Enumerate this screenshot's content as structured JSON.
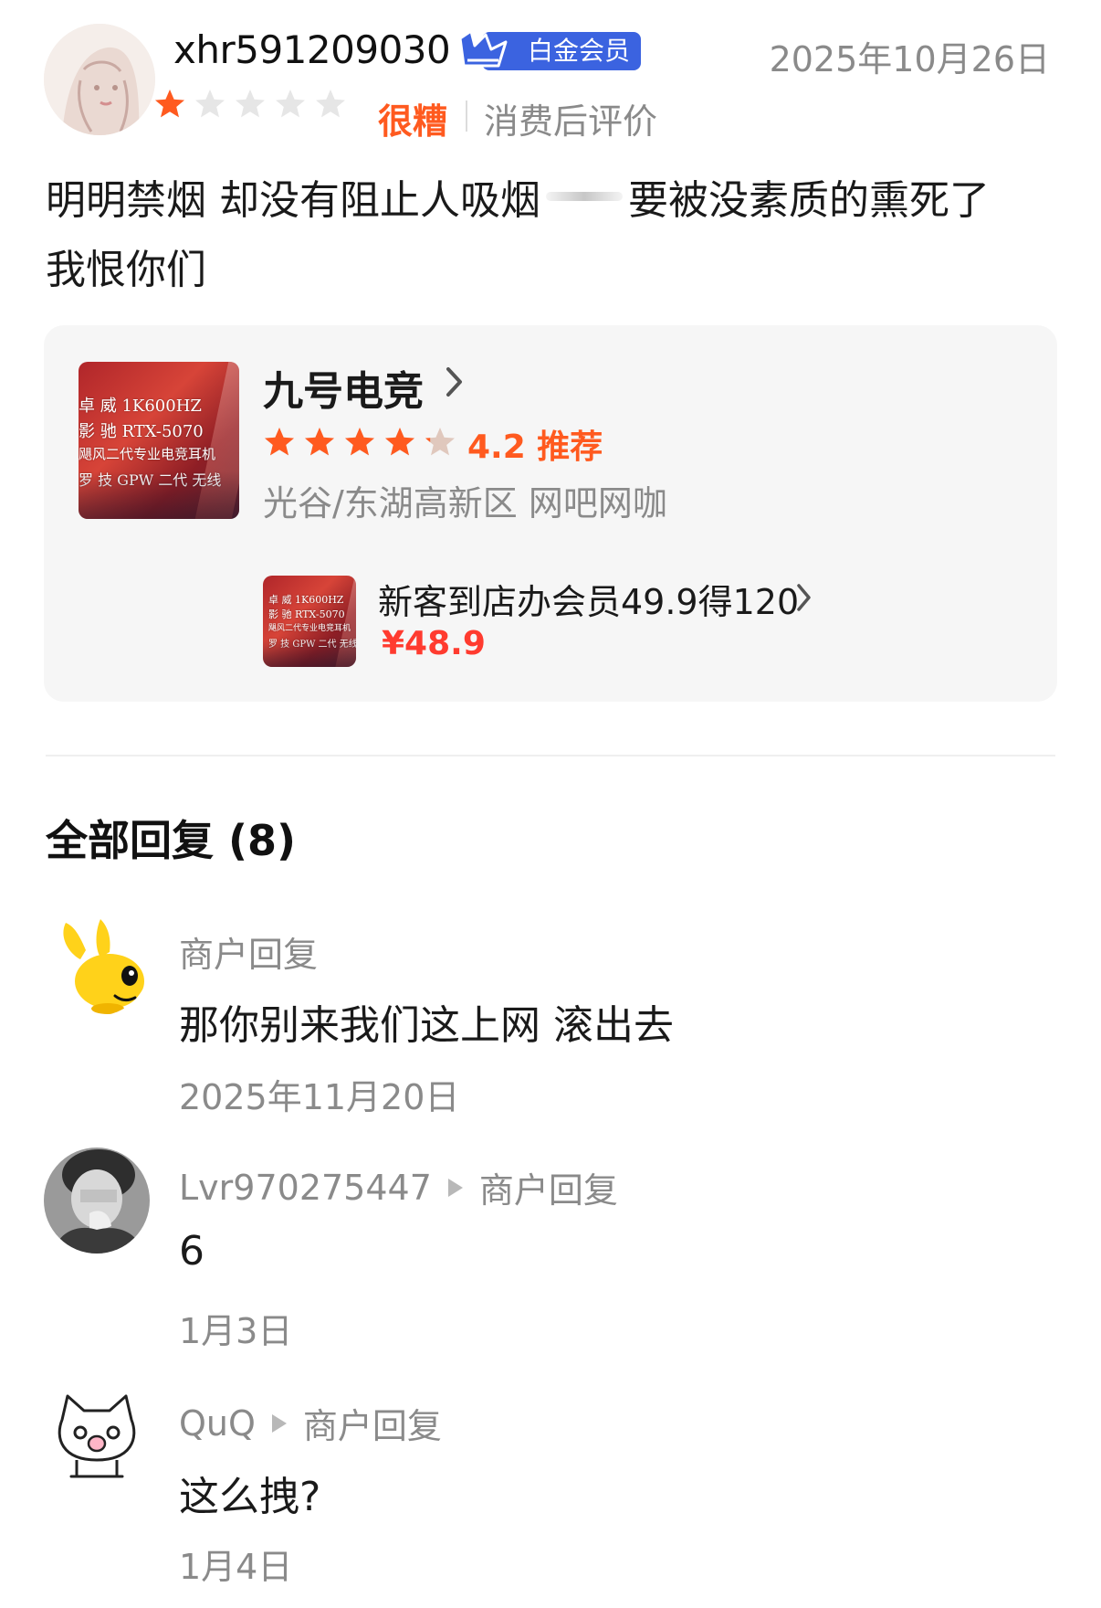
{
  "review": {
    "username": "xhr591209030",
    "badge": "白金会员",
    "date": "2025年10月26日",
    "rating_stars": 1,
    "rating_max": 5,
    "rating_word": "很糟",
    "rating_tag": "消费后评价",
    "text_part1": "明明禁烟 却没有阻止人吸烟",
    "text_part2": "要被没素质的熏死了",
    "text_line2": "我恨你们",
    "colors": {
      "accent": "#ff5a1f",
      "badge": "#3b63e0",
      "muted": "#8a8a8a"
    }
  },
  "shop": {
    "name": "九号电竞",
    "rating": 4.2,
    "score_text": "4.2 推荐",
    "meta": "光谷/东湖高新区 网吧网咖",
    "image_lines": [
      "卓 威 1K600HZ",
      "影 驰 RTX-5070",
      "飓风二代专业电竞耳机",
      "罗 技 GPW 二代 无线"
    ],
    "deal": {
      "title": "新客到店办会员49.9得120",
      "price": "¥48.9"
    }
  },
  "replies_section": {
    "title": "全部回复 (8)",
    "items": [
      {
        "author": "商户回复",
        "reply_to": "",
        "text": "那你别来我们这上网 滚出去",
        "date": "2025年11月20日",
        "avatar": "yellow-rabbit-mascot"
      },
      {
        "author": "Lvr970275447",
        "reply_to": "商户回复",
        "text": "6",
        "date": "1月3日",
        "avatar": "grayscale-person-photo"
      },
      {
        "author": "QuQ",
        "reply_to": "商户回复",
        "text": "这么拽?",
        "date": "1月4日",
        "avatar": "white-cat-sticker"
      }
    ]
  }
}
